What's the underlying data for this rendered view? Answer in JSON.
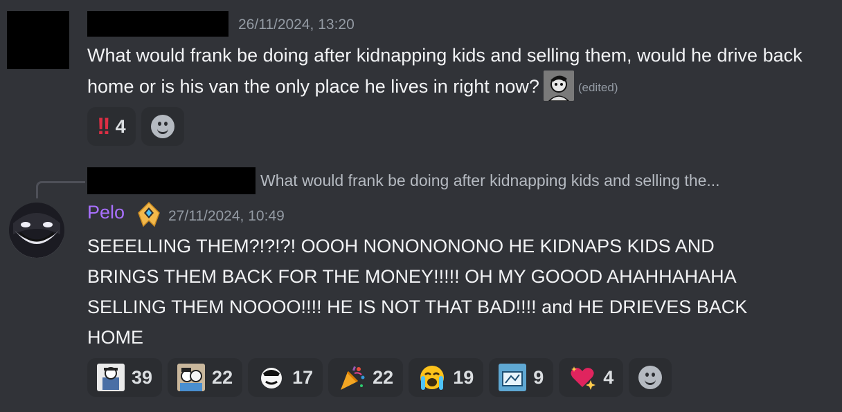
{
  "message1": {
    "timestamp": "26/11/2024, 13:20",
    "text": "What would frank be doing after kidnapping kids and selling them, would he drive back home or is his van the only place he lives in right now?",
    "edited": "(edited)",
    "reactions": [
      {
        "emoji": "double-exclamation",
        "count": "4"
      }
    ]
  },
  "reply": {
    "preview": "What would frank be doing after kidnapping kids and selling the..."
  },
  "message2": {
    "username": "Pelo",
    "username_color": "#a970ff",
    "timestamp": "27/11/2024, 10:49",
    "text": "SEEELLING THEM?!?!?! OOOH NONONONONO HE KIDNAPS KIDS AND BRINGS THEM BACK FOR THE MONEY!!!!! OH MY GOOOD AHAHHAHAHA SELLING THEM NOOOO!!!! HE IS NOT THAT BAD!!!! and HE DRIEVES BACK HOME",
    "reactions": [
      {
        "emoji": "custom-character-1",
        "count": "39"
      },
      {
        "emoji": "custom-character-2",
        "count": "22"
      },
      {
        "emoji": "custom-character-3",
        "count": "17"
      },
      {
        "emoji": "party-popper",
        "count": "22"
      },
      {
        "emoji": "loudly-crying-face",
        "count": "19"
      },
      {
        "emoji": "custom-character-4",
        "count": "9"
      },
      {
        "emoji": "sparkling-heart",
        "count": "4"
      }
    ]
  }
}
